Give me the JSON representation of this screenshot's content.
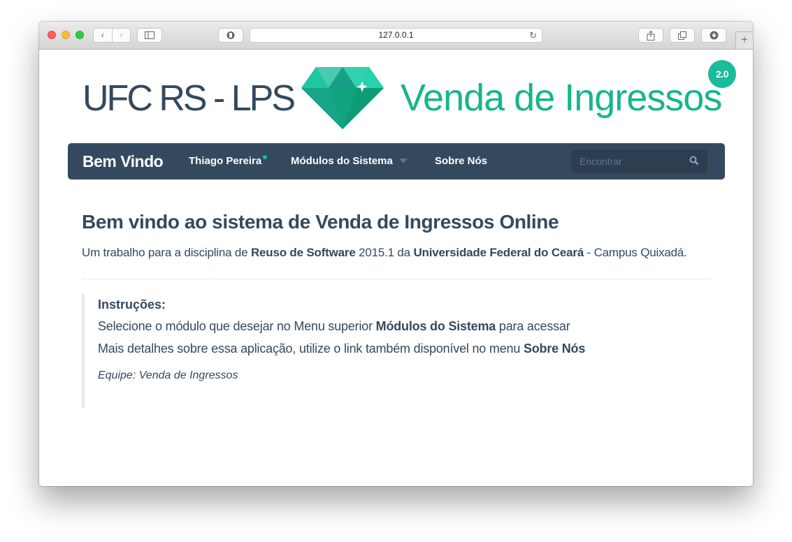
{
  "browser": {
    "url": "127.0.0.1",
    "back_glyph": "‹",
    "forward_glyph": "›",
    "new_tab_glyph": "+"
  },
  "header": {
    "logo_left": "UFC RS - LPS",
    "logo_right": "Venda de Ingressos",
    "version_badge": "2.0",
    "accent_color": "#1abc9c"
  },
  "navbar": {
    "brand": "Bem Vindo",
    "user": "Thiago Pereira",
    "modules": "Módulos do Sistema",
    "about": "Sobre Nós",
    "search_placeholder": "Encontrar",
    "background": "#34495e"
  },
  "main": {
    "headline": "Bem vindo ao sistema de Venda de Ingressos Online",
    "lead": {
      "t1": "Um trabalho para a disciplina de ",
      "b1": "Reuso de Software",
      "t2": " 2015.1 da ",
      "b2": "Universidade Federal do Ceará",
      "t3": " - Campus Quixadá."
    },
    "instructions": {
      "title": "Instruções:",
      "line1_text": "Selecione o módulo que desejar no Menu superior ",
      "line1_bold": "Módulos do Sistema",
      "line1_end": " para acessar",
      "line2_text": "Mais detalhes sobre essa aplicação, utilize o link também disponível no menu ",
      "line2_bold": "Sobre Nós",
      "signature": "Equipe: Venda de Ingressos"
    }
  }
}
